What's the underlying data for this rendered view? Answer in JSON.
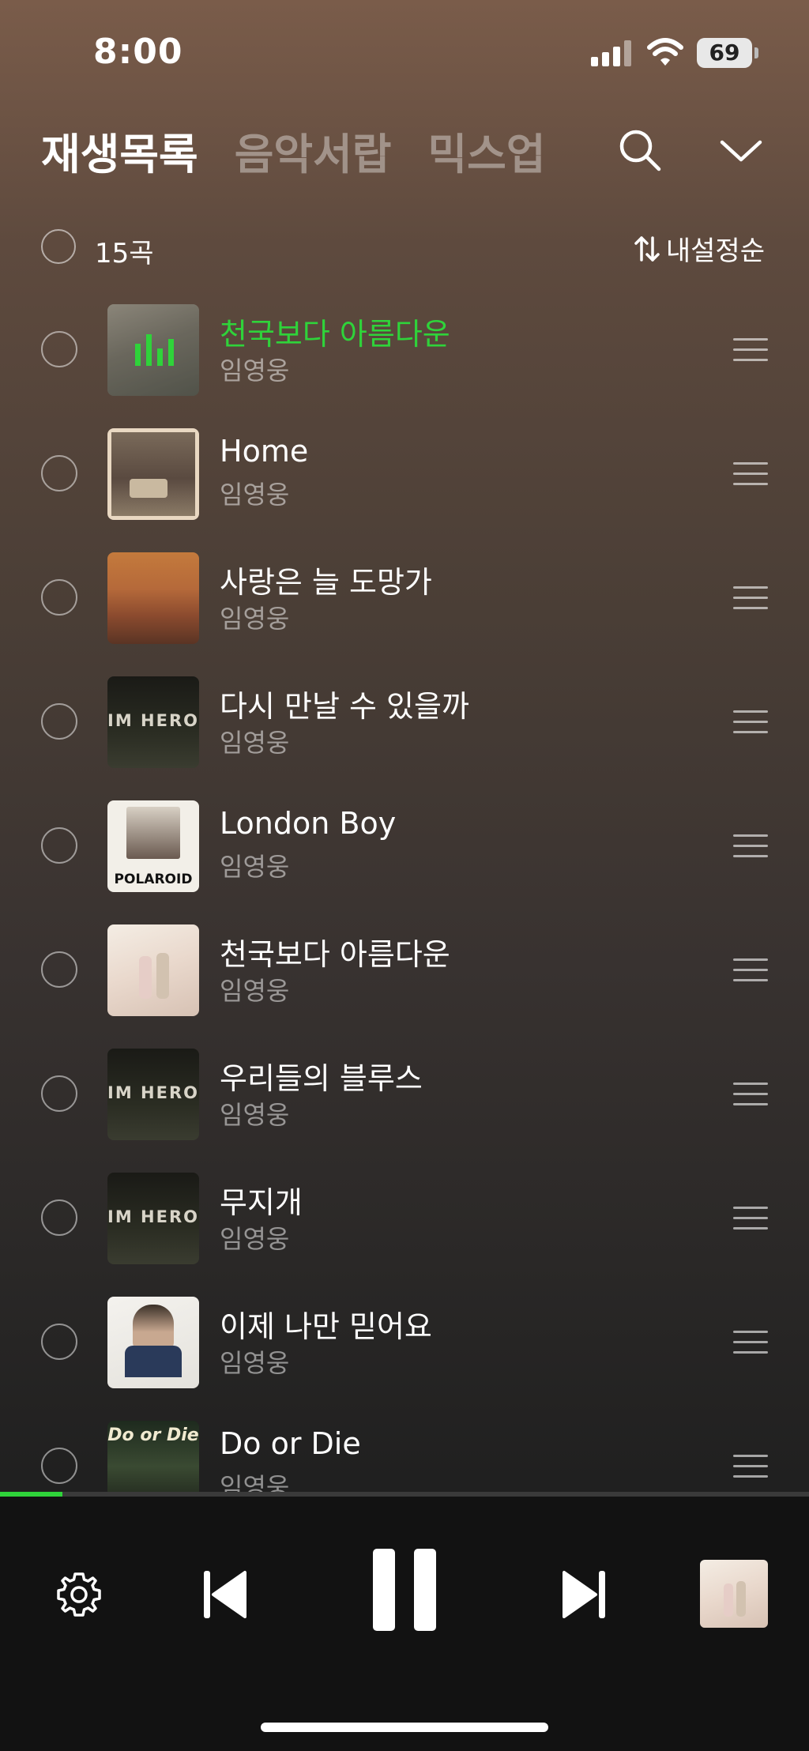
{
  "status": {
    "time": "8:00",
    "battery": "69"
  },
  "tabs": [
    {
      "label": "재생목록",
      "active": true
    },
    {
      "label": "음악서랍",
      "active": false
    },
    {
      "label": "믹스업",
      "active": false
    }
  ],
  "toolbar": {
    "count": "15곡",
    "sort_label": "내설정순"
  },
  "tracks": [
    {
      "title": "천국보다 아름다운",
      "artist": "임영웅",
      "playing": true
    },
    {
      "title": "Home",
      "artist": "임영웅"
    },
    {
      "title": "사랑은 늘 도망가",
      "artist": "임영웅"
    },
    {
      "title": "다시 만날 수 있을까",
      "artist": "임영웅"
    },
    {
      "title": "London Boy",
      "artist": "임영웅"
    },
    {
      "title": "천국보다 아름다운",
      "artist": "임영웅"
    },
    {
      "title": "우리들의 블루스",
      "artist": "임영웅"
    },
    {
      "title": "무지개",
      "artist": "임영웅"
    },
    {
      "title": "이제 나만 믿어요",
      "artist": "임영웅"
    },
    {
      "title": "Do or Die",
      "artist": "임영웅"
    }
  ],
  "album_art": {
    "im_hero_text": "IM HERO",
    "polaroid_text": "POLAROID",
    "do_or_die_text": "Do or Die"
  },
  "player": {
    "progress": 0.077
  },
  "colors": {
    "accent": "#2fd33a",
    "background_bottom": "#121212"
  }
}
